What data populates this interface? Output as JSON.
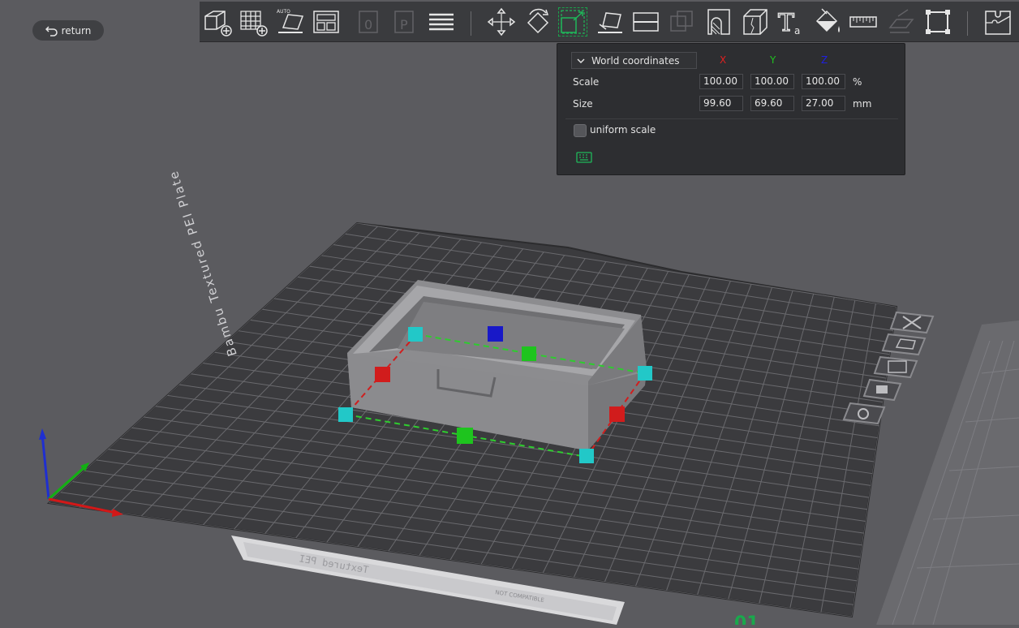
{
  "return_button": {
    "label": "return",
    "icon": "undo-arrow-icon"
  },
  "toolbar": {
    "items": [
      {
        "name": "add-object",
        "icon": "cube-plus-icon"
      },
      {
        "name": "add-plate",
        "icon": "grid-plus-icon"
      },
      {
        "name": "auto-orient",
        "icon": "auto-orient-icon",
        "text": "AUTO"
      },
      {
        "name": "arrange",
        "icon": "arrange-icon"
      },
      {
        "name": "split-objects",
        "icon": "split-objects-icon"
      },
      {
        "name": "split-parts",
        "icon": "split-parts-icon"
      },
      {
        "name": "variable-layer-height",
        "icon": "layers-icon"
      },
      {
        "name": "move",
        "icon": "move-icon"
      },
      {
        "name": "rotate",
        "icon": "rotate-icon"
      },
      {
        "name": "scale",
        "icon": "scale-icon",
        "active": true
      },
      {
        "name": "lay-on-face",
        "icon": "lay-on-face-icon"
      },
      {
        "name": "cut",
        "icon": "cut-icon"
      },
      {
        "name": "boolean",
        "icon": "boolean-icon"
      },
      {
        "name": "support-painting",
        "icon": "support-paint-icon"
      },
      {
        "name": "seam-painting",
        "icon": "seam-paint-icon"
      },
      {
        "name": "text",
        "icon": "text-icon",
        "text": "T",
        "subtext": "a"
      },
      {
        "name": "color-painting",
        "icon": "paint-bucket-icon"
      },
      {
        "name": "measure",
        "icon": "ruler-icon"
      },
      {
        "name": "assembly",
        "icon": "assembly-icon"
      },
      {
        "name": "bounding-box",
        "icon": "bounding-box-icon"
      },
      {
        "name": "explode",
        "icon": "puzzle-icon"
      }
    ]
  },
  "scale_panel": {
    "coordinate_system": "World coordinates",
    "axes": [
      {
        "label": "X",
        "color": "#e02020"
      },
      {
        "label": "Y",
        "color": "#20c020"
      },
      {
        "label": "Z",
        "color": "#2020e0"
      }
    ],
    "scale": {
      "label": "Scale",
      "values": [
        "100.00",
        "100.00",
        "100.00"
      ],
      "unit": "%"
    },
    "size": {
      "label": "Size",
      "values": [
        "99.60",
        "69.60",
        "27.00"
      ],
      "unit": "mm"
    },
    "uniform_scale": {
      "label": "uniform scale",
      "checked": false
    },
    "keyboard_icon": "keyboard-icon"
  },
  "plate": {
    "name": "Bambu Textured PEI Plate",
    "label_strip": "Textured PEI",
    "label_small": "NOT COMPATIBLE",
    "number": "01",
    "side_buttons": [
      {
        "name": "delete",
        "icon": "close-x-icon"
      },
      {
        "name": "orient",
        "icon": "orient-icon"
      },
      {
        "name": "arrange",
        "icon": "arrange-icon"
      },
      {
        "name": "lock",
        "icon": "lock-icon"
      },
      {
        "name": "settings",
        "icon": "settings-icon"
      }
    ]
  },
  "colors": {
    "background": "#5b5b5f",
    "plate": "#3a3a3d",
    "grid_line": "#6c6c70",
    "model": "#8e8e90",
    "handle_x": "#d11c1c",
    "handle_y": "#1ec41e",
    "handle_z": "#1818c8",
    "handle_corner": "#22c8c8",
    "panel": "#2d2e31",
    "active_tool": "#19a44b"
  }
}
